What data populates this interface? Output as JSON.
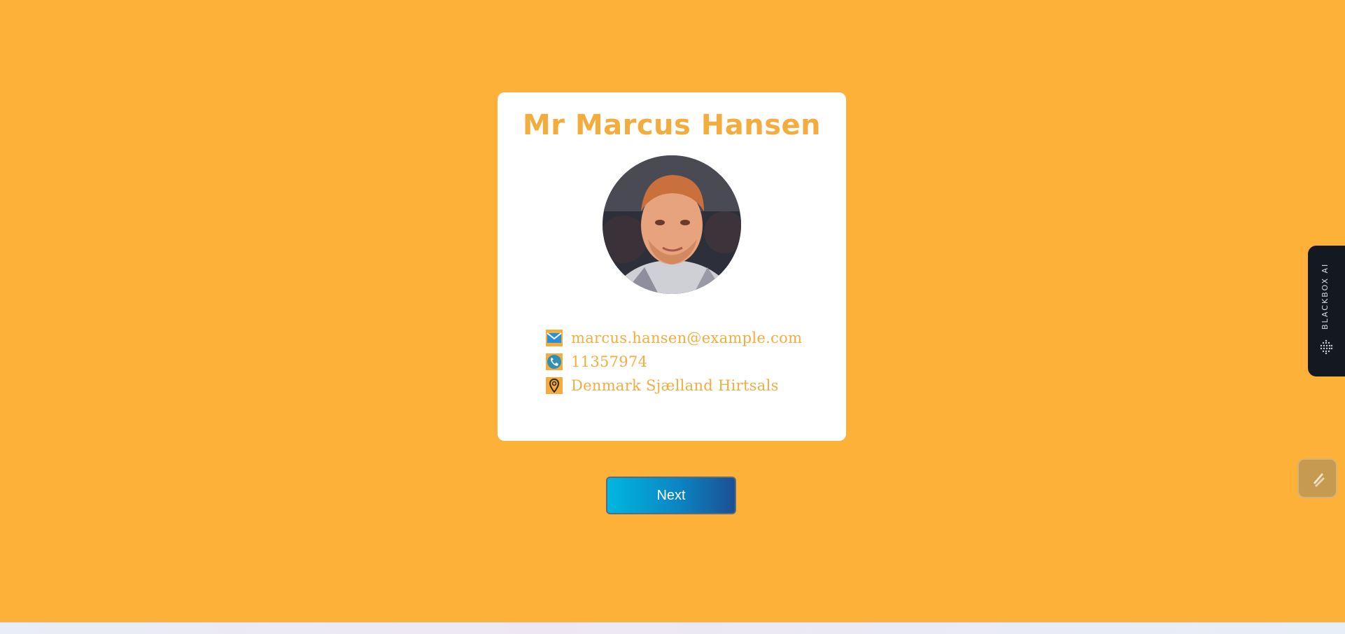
{
  "profile": {
    "name": "Mr Marcus Hansen",
    "email": "marcus.hansen@example.com",
    "phone": "11357974",
    "location": "Denmark Sjælland Hirtsals"
  },
  "icons": {
    "email": "envelope-icon",
    "phone": "phone-icon",
    "location": "map-pin-icon"
  },
  "actions": {
    "next_label": "Next"
  },
  "extension": {
    "side_tab_label": "BLACKBOX AI"
  },
  "colors": {
    "background": "#fdb138",
    "accent_text": "#f3ad3e",
    "button_start": "#00b7e0",
    "button_end": "#1b4f93"
  }
}
